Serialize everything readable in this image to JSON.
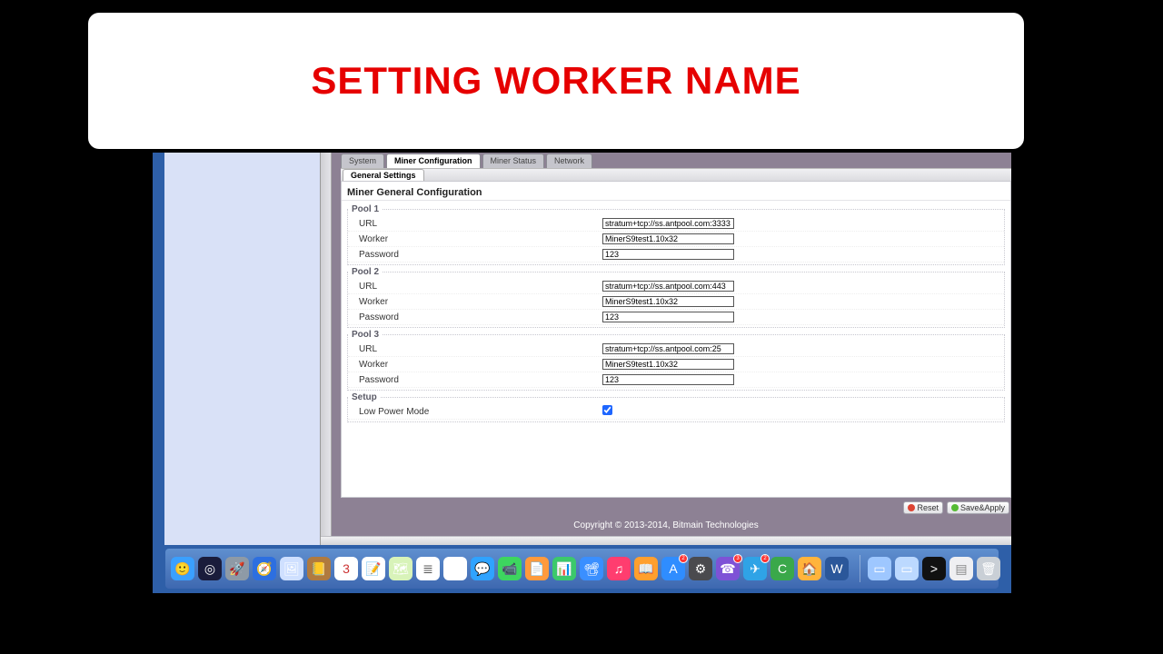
{
  "banner": {
    "title": "SETTING WORKER NAME"
  },
  "tabs": {
    "system": "System",
    "miner_config": "Miner Configuration",
    "miner_status": "Miner Status",
    "network": "Network"
  },
  "subtabs": {
    "general": "General Settings"
  },
  "heading": "Miner General Configuration",
  "pools": [
    {
      "legend": "Pool 1",
      "url_label": "URL",
      "url": "stratum+tcp://ss.antpool.com:3333",
      "worker_label": "Worker",
      "worker": "MinerS9test1.10x32",
      "pass_label": "Password",
      "pass": "123"
    },
    {
      "legend": "Pool 2",
      "url_label": "URL",
      "url": "stratum+tcp://ss.antpool.com:443",
      "worker_label": "Worker",
      "worker": "MinerS9test1.10x32",
      "pass_label": "Password",
      "pass": "123"
    },
    {
      "legend": "Pool 3",
      "url_label": "URL",
      "url": "stratum+tcp://ss.antpool.com:25",
      "worker_label": "Worker",
      "worker": "MinerS9test1.10x32",
      "pass_label": "Password",
      "pass": "123"
    }
  ],
  "setup": {
    "legend": "Setup",
    "low_power_label": "Low Power Mode",
    "low_power": true
  },
  "buttons": {
    "reset": "Reset",
    "save": "Save&Apply"
  },
  "copyright": "Copyright © 2013-2014, Bitmain Technologies",
  "dock": [
    {
      "name": "finder-icon",
      "glyph": "🙂",
      "bg": "#3aa0ff"
    },
    {
      "name": "siri-icon",
      "glyph": "◎",
      "bg": "#1a1c3b"
    },
    {
      "name": "launchpad-icon",
      "glyph": "🚀",
      "bg": "#8e9aa6"
    },
    {
      "name": "safari-icon",
      "glyph": "🧭",
      "bg": "#2d6fe0"
    },
    {
      "name": "preview-icon",
      "glyph": "🖼",
      "bg": "#cfe0ff"
    },
    {
      "name": "contacts-icon",
      "glyph": "📒",
      "bg": "#b07a3f"
    },
    {
      "name": "calendar-icon",
      "glyph": "3",
      "bg": "#fff",
      "fg": "#c33"
    },
    {
      "name": "notes-icon",
      "glyph": "📝",
      "bg": "#fff"
    },
    {
      "name": "maps-icon",
      "glyph": "🗺",
      "bg": "#d8f3b9"
    },
    {
      "name": "reminders-icon",
      "glyph": "≣",
      "bg": "#fff",
      "fg": "#555"
    },
    {
      "name": "photos-icon",
      "glyph": "✿",
      "bg": "#fff"
    },
    {
      "name": "messages-icon",
      "glyph": "💬",
      "bg": "#2fa3ff"
    },
    {
      "name": "facetime-icon",
      "glyph": "📹",
      "bg": "#3dd65f"
    },
    {
      "name": "pages-icon",
      "glyph": "📄",
      "bg": "#ff9a3c"
    },
    {
      "name": "numbers-icon",
      "glyph": "📊",
      "bg": "#3cc96b"
    },
    {
      "name": "keynote-icon",
      "glyph": "📽",
      "bg": "#3a8fff"
    },
    {
      "name": "itunes-icon",
      "glyph": "♫",
      "bg": "#ff3d6f"
    },
    {
      "name": "ibooks-icon",
      "glyph": "📖",
      "bg": "#ff9f2e"
    },
    {
      "name": "appstore-icon",
      "glyph": "A",
      "bg": "#2f8dff",
      "badge": "2"
    },
    {
      "name": "settings-icon",
      "glyph": "⚙",
      "bg": "#4a4a4e"
    },
    {
      "name": "viber-icon",
      "glyph": "☎",
      "bg": "#7e52d6",
      "badge": "3"
    },
    {
      "name": "telegram-icon",
      "glyph": "✈",
      "bg": "#2fa3e6",
      "badge": "2"
    },
    {
      "name": "camtasia-icon",
      "glyph": "C",
      "bg": "#3aa84a"
    },
    {
      "name": "home-icon",
      "glyph": "🏠",
      "bg": "#ffb43c"
    },
    {
      "name": "word-icon",
      "glyph": "W",
      "bg": "#2b579a"
    }
  ],
  "dock_right": [
    {
      "name": "desktop-thumb-icon",
      "glyph": "▭",
      "bg": "#9ec7ff"
    },
    {
      "name": "desktop2-thumb-icon",
      "glyph": "▭",
      "bg": "#bcd9ff"
    },
    {
      "name": "terminal-icon",
      "glyph": ">",
      "bg": "#111"
    },
    {
      "name": "doc-icon",
      "glyph": "▤",
      "bg": "#efeff2",
      "fg": "#888"
    },
    {
      "name": "trash-icon",
      "glyph": "🗑",
      "bg": "#c9cfd6"
    }
  ]
}
